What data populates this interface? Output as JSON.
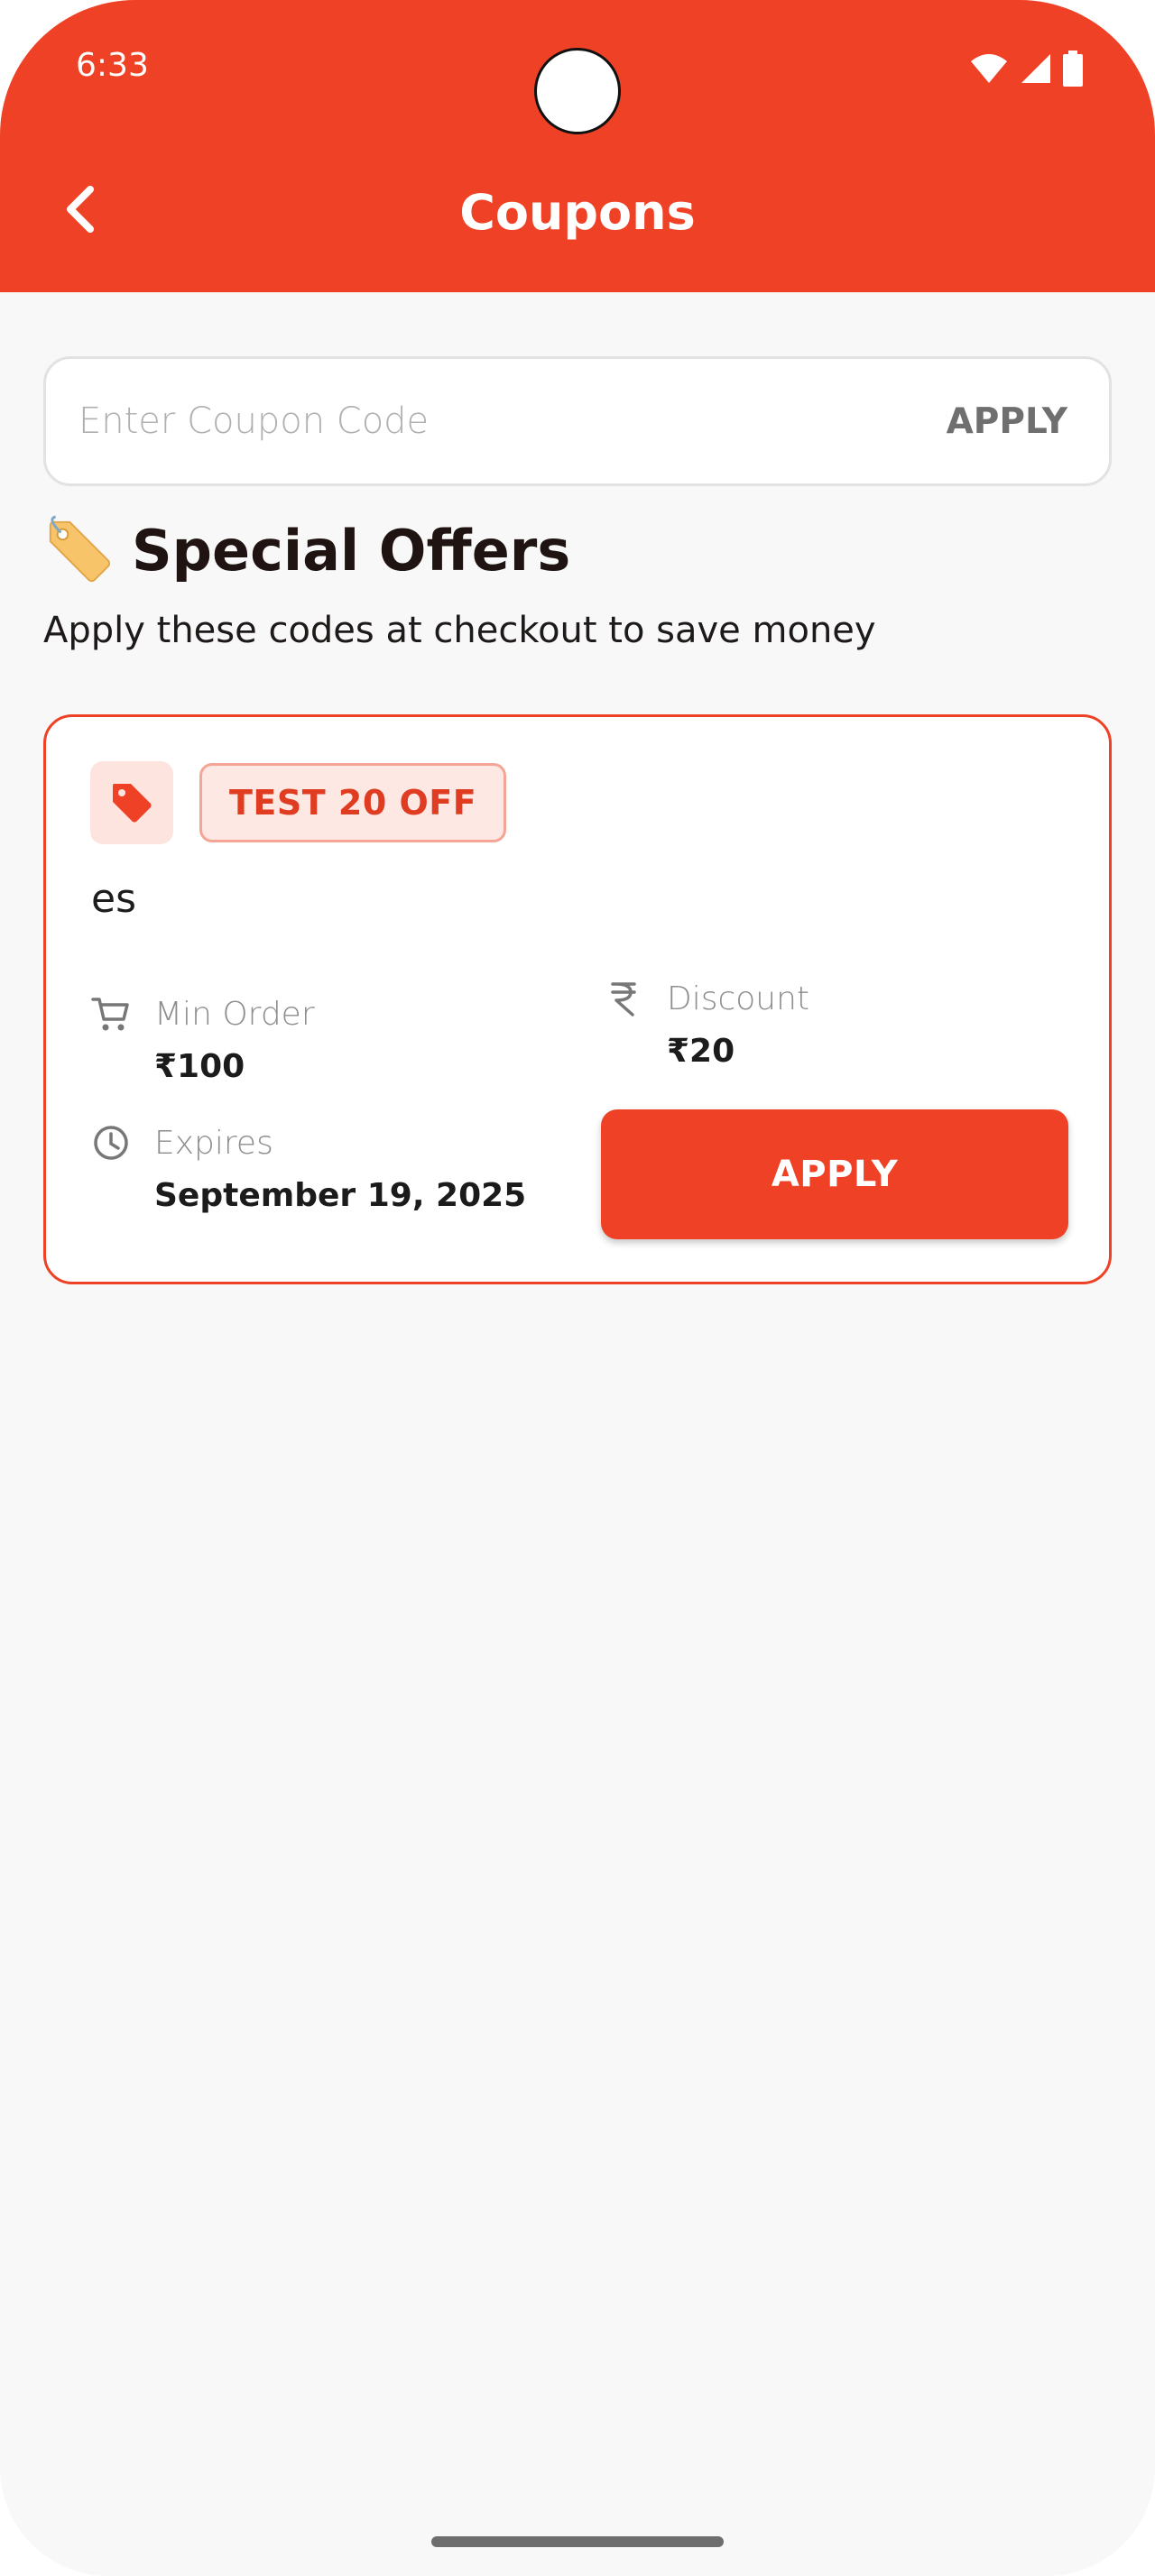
{
  "status_bar": {
    "time": "6:33"
  },
  "header": {
    "title": "Coupons"
  },
  "coupon_input": {
    "placeholder": "Enter Coupon Code",
    "value": "",
    "apply_label": "APPLY"
  },
  "section": {
    "title": "Special Offers",
    "subtitle": "Apply these codes at checkout to save money"
  },
  "coupons": [
    {
      "code": "TEST 20 OFF",
      "description": "es",
      "min_order_label": "Min Order",
      "min_order_value": "₹100",
      "discount_label": "Discount",
      "discount_value": "₹20",
      "expires_label": "Expires",
      "expires_value": "September 19, 2025",
      "apply_label": "APPLY"
    }
  ],
  "colors": {
    "primary": "#ef4125",
    "background": "#f8f8f8",
    "pill_bg": "#fde8e4"
  }
}
